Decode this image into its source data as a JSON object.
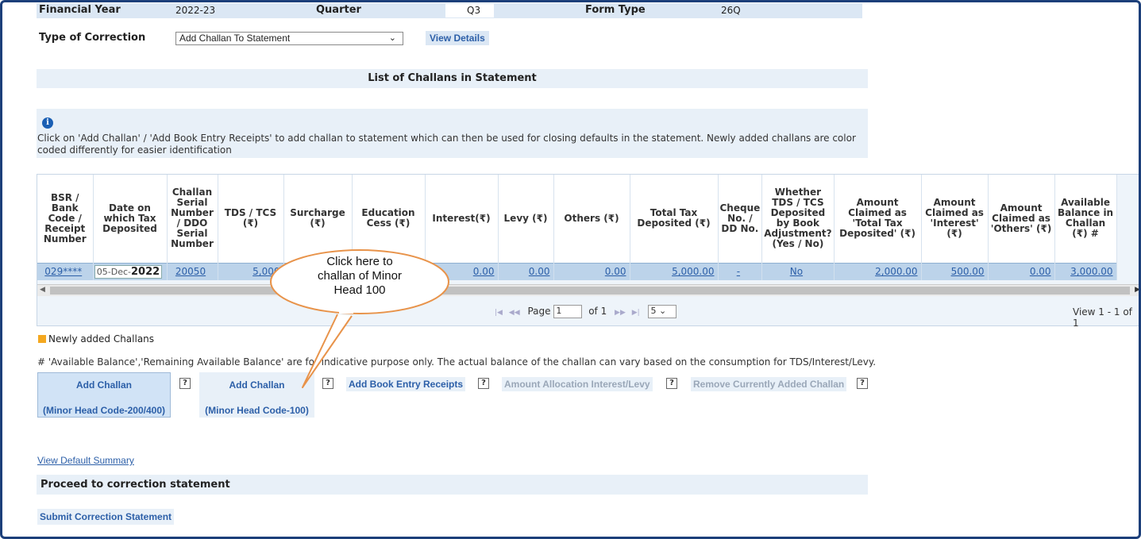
{
  "header": {
    "fy_label": "Financial Year",
    "fy_value": "2022-23",
    "quarter_label": "Quarter",
    "quarter_value": "Q3",
    "form_label": "Form Type",
    "form_value": "26Q"
  },
  "correction": {
    "label": "Type of Correction",
    "selected": "Add Challan To Statement",
    "view_details": "View Details"
  },
  "list_title": "List of Challans in Statement",
  "info_text": "Click on 'Add Challan' / 'Add Book Entry Receipts' to add challan to statement which can then be used for closing defaults in the statement. Newly added challans are color coded differently for easier identification",
  "table": {
    "headers": [
      "BSR / Bank Code / Receipt Number",
      "Date on which Tax Deposited",
      "Challan Serial Number / DDO Serial Number",
      "TDS / TCS (₹)",
      "Surcharge (₹)",
      "Education Cess (₹)",
      "Interest(₹)",
      "Levy (₹)",
      "Others (₹)",
      "Total Tax Deposited (₹)",
      "Cheque No. / DD No.",
      "Whether TDS / TCS Deposited by Book Adjustment? (Yes / No)",
      "Amount Claimed as 'Total Tax Deposited' (₹)",
      "Amount Claimed as 'Interest' (₹)",
      "Amount Claimed as 'Others' (₹)",
      "Available Balance in Challan (₹) #"
    ],
    "row": {
      "bsr": "029****",
      "date_prefix": "05-Dec-",
      "date_year": "2022",
      "serial": "20050",
      "tds": "5,000",
      "interest": "0.00",
      "levy": "0.00",
      "others": "0.00",
      "total": "5,000.00",
      "cheque": "-",
      "book_adj": "No",
      "claimed_total": "2,000.00",
      "claimed_interest": "500.00",
      "claimed_others": "0.00",
      "available": "3,000.00"
    }
  },
  "pager": {
    "page_label": "Page",
    "page_value": "1",
    "of_label": "of 1",
    "per_page": "5",
    "view_text": "View 1 - 1 of 1"
  },
  "legend_text": "Newly added Challans",
  "note_text": "# 'Available Balance','Remaining Available Balance' are for indicative purpose only. The actual balance of the challan can vary based on the consumption for TDS/Interest/Levy.",
  "buttons": {
    "add_challan_1_line1": "Add Challan",
    "add_challan_1_line2": "(Minor Head Code-200/400)",
    "add_challan_2_line1": "Add Challan",
    "add_challan_2_line2": "(Minor Head Code-100)",
    "add_book_entry": "Add Book Entry Receipts",
    "amount_allocation": "Amount Allocation Interest/Levy",
    "remove_challan": "Remove Currently Added Challan",
    "help": "?"
  },
  "view_default_summary": "View Default Summary",
  "proceed_label": "Proceed to correction statement",
  "submit_label": "Submit Correction Statement",
  "callout": {
    "line1": "Click here to",
    "line2": "challan of Minor",
    "line3": "Head 100"
  }
}
